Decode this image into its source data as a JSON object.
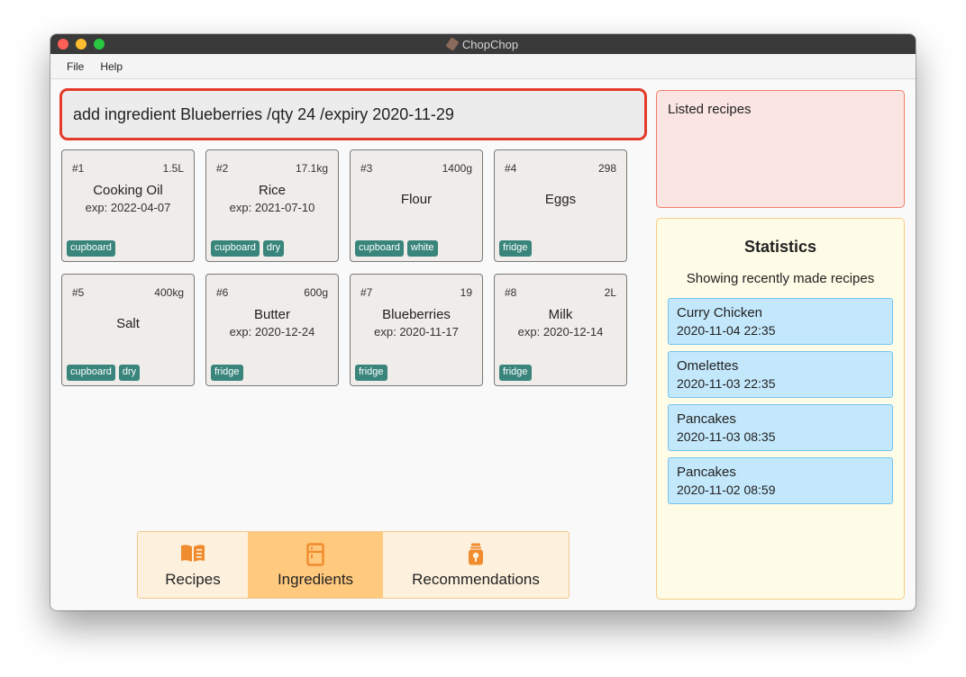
{
  "window": {
    "title": "ChopChop"
  },
  "menu": {
    "file": "File",
    "help": "Help"
  },
  "command": {
    "text": "add ingredient Blueberries /qty 24 /expiry 2020-11-29"
  },
  "ingredients": [
    {
      "index": "#1",
      "qty": "1.5L",
      "name": "Cooking Oil",
      "expiry": "exp: 2022-04-07",
      "tags": [
        "cupboard"
      ]
    },
    {
      "index": "#2",
      "qty": "17.1kg",
      "name": "Rice",
      "expiry": "exp: 2021-07-10",
      "tags": [
        "cupboard",
        "dry"
      ]
    },
    {
      "index": "#3",
      "qty": "1400g",
      "name": "Flour",
      "expiry": "",
      "tags": [
        "cupboard",
        "white"
      ]
    },
    {
      "index": "#4",
      "qty": "298",
      "name": "Eggs",
      "expiry": "",
      "tags": [
        "fridge"
      ]
    },
    {
      "index": "#5",
      "qty": "400kg",
      "name": "Salt",
      "expiry": "",
      "tags": [
        "cupboard",
        "dry"
      ]
    },
    {
      "index": "#6",
      "qty": "600g",
      "name": "Butter",
      "expiry": "exp: 2020-12-24",
      "tags": [
        "fridge"
      ]
    },
    {
      "index": "#7",
      "qty": "19",
      "name": "Blueberries",
      "expiry": "exp: 2020-11-17",
      "tags": [
        "fridge"
      ]
    },
    {
      "index": "#8",
      "qty": "2L",
      "name": "Milk",
      "expiry": "exp: 2020-12-14",
      "tags": [
        "fridge"
      ]
    }
  ],
  "tabs": {
    "recipes": {
      "label": "Recipes",
      "icon": "book-icon"
    },
    "ingredients": {
      "label": "Ingredients",
      "icon": "fridge-icon",
      "selected": true
    },
    "recommendations": {
      "label": "Recommendations",
      "icon": "jar-icon"
    }
  },
  "listed": {
    "label": "Listed recipes"
  },
  "stats": {
    "title": "Statistics",
    "subtitle": "Showing recently made recipes",
    "recent": [
      {
        "name": "Curry Chicken",
        "time": "2020-11-04 22:35"
      },
      {
        "name": "Omelettes",
        "time": "2020-11-03 22:35"
      },
      {
        "name": "Pancakes",
        "time": "2020-11-03 08:35"
      },
      {
        "name": "Pancakes",
        "time": "2020-11-02 08:59"
      }
    ]
  },
  "colors": {
    "accent_orange": "#f08c2e",
    "tag_green": "#39857b",
    "command_border": "#e33a2a",
    "recent_blue": "#c3e7fb"
  }
}
